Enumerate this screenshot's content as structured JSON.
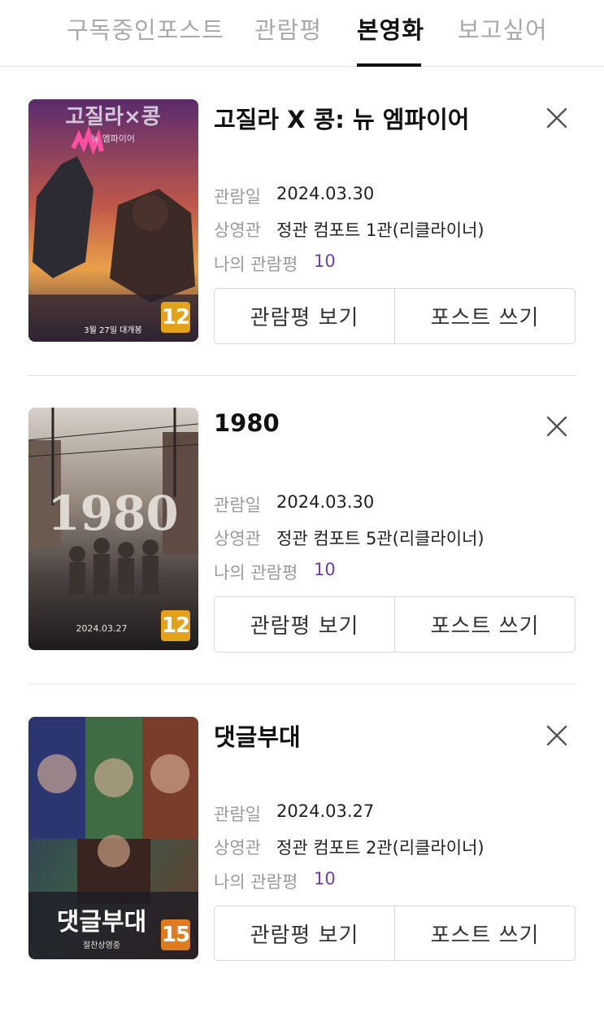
{
  "tabs": [
    {
      "label": "구독중인포스트",
      "active": false
    },
    {
      "label": "관람평",
      "active": false
    },
    {
      "label": "본영화",
      "active": true
    },
    {
      "label": "보고싶어",
      "active": false
    }
  ],
  "labels": {
    "date": "관람일",
    "theater": "상영관",
    "my_review": "나의 관람평",
    "view_review": "관람평 보기",
    "write_post": "포스트 쓰기"
  },
  "movies": [
    {
      "title": "고질라 X 콩: 뉴 엠파이어",
      "date": "2024.03.30",
      "theater": "정관 컴포트 1관(리클라이너)",
      "score": "10",
      "age_rating": "12",
      "rating_color": "#e3a21a",
      "poster_title": "고질라×콩",
      "poster_subtitle": "뉴 엠파이어",
      "poster_release": "3월 27일 대개봉",
      "icon": "close-icon"
    },
    {
      "title": "1980",
      "date": "2024.03.30",
      "theater": "정관 컴포트 5관(리클라이너)",
      "score": "10",
      "age_rating": "12",
      "rating_color": "#e3a21a",
      "poster_title": "1980",
      "poster_release": "2024.03.27",
      "icon": "close-icon"
    },
    {
      "title": "댓글부대",
      "date": "2024.03.27",
      "theater": "정관 컴포트 2관(리클라이너)",
      "score": "10",
      "age_rating": "15",
      "rating_color": "#e07a1f",
      "poster_title": "댓글부대",
      "poster_release": "절찬상영중",
      "icon": "close-icon"
    }
  ]
}
